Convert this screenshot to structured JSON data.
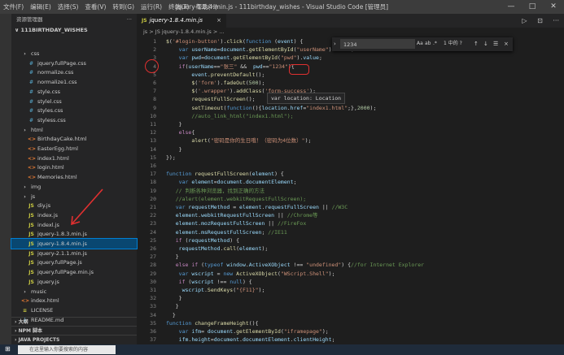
{
  "titlebar": {
    "menu": [
      "文件(F)",
      "编辑(E)",
      "选择(S)",
      "查看(V)",
      "转到(G)",
      "运行(R)",
      "终端(T)",
      "帮助(H)"
    ],
    "window_title": "jquery-1.8.4.min.js - 111birthday_wishes - Visual Studio Code [管理员]"
  },
  "sidebar": {
    "title": "资源管理器",
    "more": "···",
    "folder": "111BIRTHDAY_WISHES",
    "items": [
      {
        "label": "css",
        "icon": "folder"
      },
      {
        "label": "jquery.fullPage.css",
        "icon": "css"
      },
      {
        "label": "normalize.css",
        "icon": "css"
      },
      {
        "label": "normalize1.css",
        "icon": "css"
      },
      {
        "label": "style.css",
        "icon": "css"
      },
      {
        "label": "stylel.css",
        "icon": "css"
      },
      {
        "label": "styles.css",
        "icon": "css"
      },
      {
        "label": "styless.css",
        "icon": "css"
      },
      {
        "label": "html",
        "icon": "folder"
      },
      {
        "label": "BirthdayCake.html",
        "icon": "html"
      },
      {
        "label": "EasterEgg.html",
        "icon": "html"
      },
      {
        "label": "index1.html",
        "icon": "html"
      },
      {
        "label": "login.html",
        "icon": "html"
      },
      {
        "label": "Memories.html",
        "icon": "html"
      },
      {
        "label": "img",
        "icon": "folder"
      },
      {
        "label": "js",
        "icon": "folder"
      },
      {
        "label": "diy.js",
        "icon": "js"
      },
      {
        "label": "index.js",
        "icon": "js"
      },
      {
        "label": "indexl.js",
        "icon": "js"
      },
      {
        "label": "jquery-1.8.3.min.js",
        "icon": "js"
      },
      {
        "label": "jquery-1.8.4.min.js",
        "icon": "js",
        "selected": true
      },
      {
        "label": "jquery-2.1.1.min.js",
        "icon": "js"
      },
      {
        "label": "jquery.fullPage.js",
        "icon": "js"
      },
      {
        "label": "jquery.fullPage.min.js",
        "icon": "js"
      },
      {
        "label": "jquery.js",
        "icon": "js"
      },
      {
        "label": "music",
        "icon": "folder"
      },
      {
        "label": "index.html",
        "icon": "html"
      },
      {
        "label": "LICENSE",
        "icon": "lic"
      },
      {
        "label": "README.md",
        "icon": "md"
      }
    ],
    "sections": [
      "大纲",
      "NPM 脚本",
      "JAVA PROJECTS"
    ]
  },
  "editor": {
    "tab": {
      "label": "jquery-1.8.4.min.js",
      "icon": "JS",
      "close": "×"
    },
    "actions": [
      "▷",
      "⊡",
      "···"
    ],
    "breadcrumb": "js > JS jquery-1.8.4.min.js > ...",
    "find": {
      "query": "1234",
      "options": [
        "Aa",
        "ab",
        ".*"
      ],
      "count": "1 中的 ?",
      "buttons": [
        "↑",
        "↓",
        "☰",
        "×"
      ]
    },
    "hover": "var location: Location",
    "lines": [
      {
        "n": "1",
        "code": "$('#login-button').click(function (event) {"
      },
      {
        "n": "2",
        "code": "    var userName=document.getElementById(\"userName\").value;"
      },
      {
        "n": "3",
        "code": "    var pwd=document.getElementById(\"pwd\").value;"
      },
      {
        "n": "4",
        "code": "    if(userName==\"张三\" &&  pwd==\"1234\"){"
      },
      {
        "n": "5",
        "code": "        event.preventDefault();"
      },
      {
        "n": "6",
        "code": "        $('form').fadeOut(500);"
      },
      {
        "n": "7",
        "code": "        $('.wrapper').addClass('form-success');"
      },
      {
        "n": "8",
        "code": "        requestFullScreen();"
      },
      {
        "n": "9",
        "code": "        setTimeout(function(){location.href=\"index1.html\";},2000);"
      },
      {
        "n": "10",
        "code": "        //auto_link_html(\"index1.html\");"
      },
      {
        "n": "11",
        "code": "    }"
      },
      {
        "n": "12",
        "code": "    else{"
      },
      {
        "n": "13",
        "code": "        alert(\"密码是你的生日哦！（密码为4位数）\");"
      },
      {
        "n": "14",
        "code": "    }"
      },
      {
        "n": "15",
        "code": "});"
      },
      {
        "n": "16",
        "code": ""
      },
      {
        "n": "17",
        "code": "function requestFullScreen(element) {"
      },
      {
        "n": "18",
        "code": "    var element=document.documentElement;"
      },
      {
        "n": "19",
        "code": "   // 判断各种浏览器，找到正确的方法"
      },
      {
        "n": "20",
        "code": "   //alert(element.webkitRequestFullScreen);"
      },
      {
        "n": "21",
        "code": "   var requestMethod = element.requestFullScreen || //W3C"
      },
      {
        "n": "22",
        "code": "   element.webkitRequestFullScreen || //Chrome等"
      },
      {
        "n": "23",
        "code": "   element.mozRequestFullScreen || //FireFox"
      },
      {
        "n": "24",
        "code": "   element.msRequestFullScreen; //IE11"
      },
      {
        "n": "25",
        "code": "   if (requestMethod) {"
      },
      {
        "n": "26",
        "code": "    requestMethod.call(element);"
      },
      {
        "n": "27",
        "code": "   }"
      },
      {
        "n": "28",
        "code": "   else if (typeof window.ActiveXObject !== \"undefined\") {//for Internet Explorer"
      },
      {
        "n": "29",
        "code": "    var wscript = new ActiveXObject(\"WScript.Shell\");"
      },
      {
        "n": "30",
        "code": "    if (wscript !== null) {"
      },
      {
        "n": "31",
        "code": "     wscript.SendKeys(\"{F11}\");"
      },
      {
        "n": "32",
        "code": "    }"
      },
      {
        "n": "33",
        "code": "   }"
      },
      {
        "n": "34",
        "code": "  }"
      },
      {
        "n": "35",
        "code": "function changeFrameHeight(){"
      },
      {
        "n": "36",
        "code": "    var ifm= document.getElementById(\"iframepage\");"
      },
      {
        "n": "37",
        "code": "    ifm.height=document.documentElement.clientHeight;"
      }
    ]
  },
  "taskbar": {
    "search_placeholder": "在这里输入你要搜索的内容"
  },
  "colors": {
    "accent": "#007acc",
    "annotation": "#e03030",
    "selection": "#094771"
  }
}
